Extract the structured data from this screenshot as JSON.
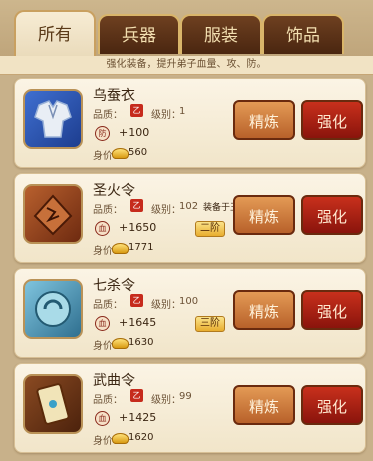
{
  "tabs": [
    {
      "label": "所有",
      "active": true
    },
    {
      "label": "兵器",
      "active": false
    },
    {
      "label": "服装",
      "active": false
    },
    {
      "label": "饰品",
      "active": false
    }
  ],
  "subtitle": "强化装备，提升弟子血量、攻、防。",
  "items": [
    {
      "name": "乌蚕衣",
      "quality_label": "品质：",
      "level_label": "级别：",
      "level": "1",
      "bonus": "+100",
      "price_label": "身价：",
      "price": "560",
      "stage": "",
      "note": "",
      "refine_label": "精炼",
      "enhance_label": "强化",
      "stat_icon": "防",
      "icon": "armor-icon"
    },
    {
      "name": "圣火令",
      "quality_label": "品质：",
      "level_label": "级别：",
      "level": "102",
      "bonus": "+1650",
      "price_label": "身价：",
      "price": "1771",
      "stage": "二阶",
      "note": "装备于王重阳",
      "refine_label": "精炼",
      "enhance_label": "强化",
      "stat_icon": "血",
      "icon": "token-icon"
    },
    {
      "name": "七杀令",
      "quality_label": "品质：",
      "level_label": "级别：",
      "level": "100",
      "bonus": "+1645",
      "price_label": "身价：",
      "price": "1630",
      "stage": "三阶",
      "note": "",
      "refine_label": "精炼",
      "enhance_label": "强化",
      "stat_icon": "血",
      "icon": "jade-icon"
    },
    {
      "name": "武曲令",
      "quality_label": "品质：",
      "level_label": "级别：",
      "level": "99",
      "bonus": "+1425",
      "price_label": "身价：",
      "price": "1620",
      "stage": "",
      "note": "",
      "refine_label": "精炼",
      "enhance_label": "强化",
      "stat_icon": "血",
      "icon": "plaque-icon"
    }
  ],
  "quality_seal": "乙",
  "colors": {
    "refine": "#c8723a",
    "enhance": "#a8201a",
    "tab_active": "#f3e6cb"
  }
}
